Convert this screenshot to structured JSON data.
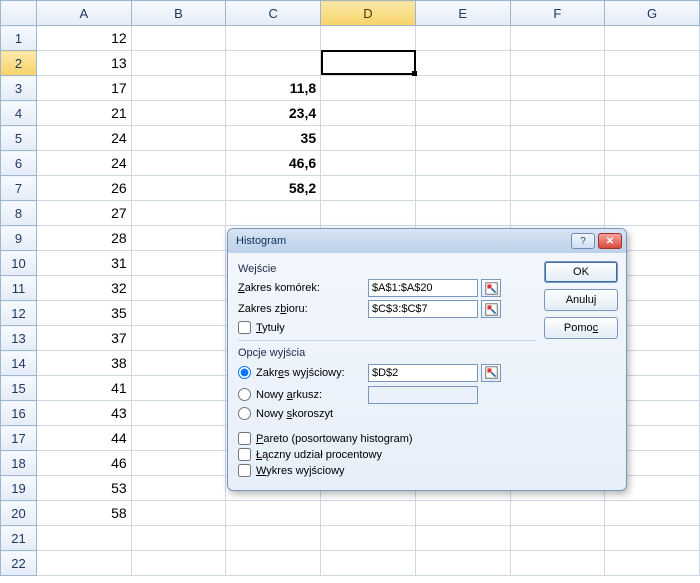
{
  "columns": [
    "A",
    "B",
    "C",
    "D",
    "E",
    "F",
    "G"
  ],
  "rows": 22,
  "colA": [
    "12",
    "13",
    "17",
    "21",
    "24",
    "24",
    "26",
    "27",
    "28",
    "31",
    "32",
    "35",
    "37",
    "38",
    "41",
    "43",
    "44",
    "46",
    "53",
    "58"
  ],
  "colC": {
    "3": "11,8",
    "4": "23,4",
    "5": "35",
    "6": "46,6",
    "7": "58,2"
  },
  "activeCell": {
    "col": "D",
    "row": 2
  },
  "dialog": {
    "title": "Histogram",
    "section_input": "Wejście",
    "lbl_range": "Zakres komórek:",
    "val_range": "$A$1:$A$20",
    "lbl_bins": "Zakres zbioru:",
    "val_bins": "$C$3:$C$7",
    "chk_titles": "Tytuły",
    "section_output": "Opcje wyjścia",
    "rad_outrange": "Zakres wyjściowy:",
    "val_outrange": "$D$2",
    "rad_newsheet": "Nowy arkusz:",
    "rad_newbook": "Nowy skoroszyt",
    "chk_pareto": "Pareto (posortowany histogram)",
    "chk_cumpct": "Łączny udział procentowy",
    "chk_chart": "Wykres wyjściowy",
    "btn_ok": "OK",
    "btn_cancel": "Anuluj",
    "btn_help": "Pomoc"
  }
}
